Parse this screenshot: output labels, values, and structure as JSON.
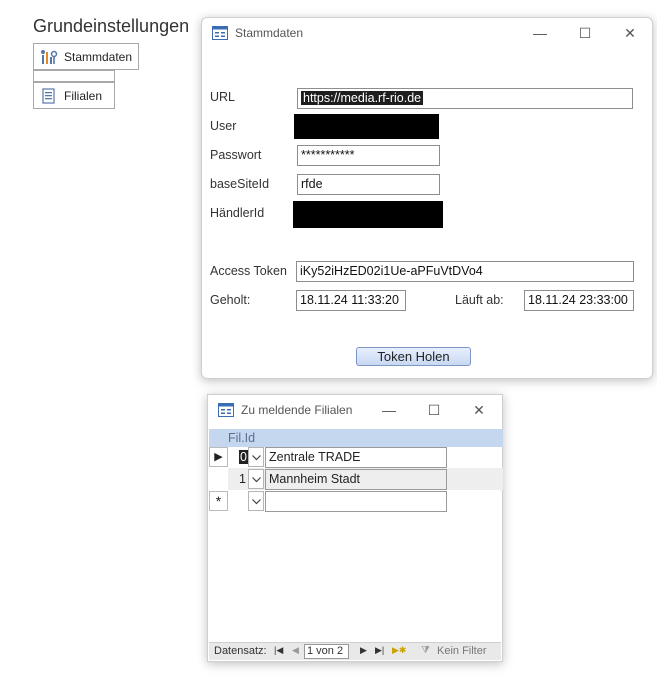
{
  "main": {
    "title": "Grundeinstellungen",
    "buttons": [
      {
        "label": "Stammdaten",
        "icon": "stammdaten-icon"
      },
      {
        "label": "Filialen",
        "icon": "filialen-icon"
      }
    ]
  },
  "stammdaten_window": {
    "title": "Stammdaten",
    "controls": {
      "minimize": "—",
      "maximize": "☐",
      "close": "✕"
    },
    "labels": {
      "url": "URL",
      "user": "User",
      "passwort": "Passwort",
      "base_site_id": "baseSiteId",
      "haendler_id": "HändlerId",
      "access_token": "Access Token",
      "geholt": "Geholt:",
      "laeuft_ab": "Läuft ab:"
    },
    "values": {
      "url": "https://media.rf-rio.de",
      "passwort": "***********",
      "base_site_id": "rfde",
      "access_token": "iKy52iHzED02i1Ue-aPFuVtDVo4",
      "geholt": "18.11.24 11:33:20",
      "laeuft_ab": "18.11.24 23:33:00"
    },
    "token_button": "Token Holen"
  },
  "filialen_window": {
    "title": "Zu meldende Filialen",
    "controls": {
      "minimize": "—",
      "maximize": "☐",
      "close": "✕"
    },
    "column_header": "Fil.Id",
    "rows": [
      {
        "selector": "▶",
        "id": "0",
        "name": "Zentrale TRADE"
      },
      {
        "selector": "",
        "id": "1",
        "name": "Mannheim Stadt"
      },
      {
        "selector": "*",
        "id": "",
        "name": ""
      }
    ],
    "status": {
      "label": "Datensatz:",
      "record": "1 von 2",
      "filter": "Kein Filter"
    }
  }
}
